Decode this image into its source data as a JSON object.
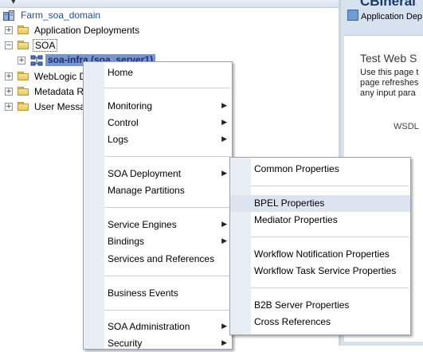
{
  "tree": {
    "root_label": "Farm_soa_domain",
    "items": [
      {
        "label": "Application Deployments",
        "expander": "+"
      },
      {
        "label": "SOA",
        "expander": "−"
      },
      {
        "label": "soa-infra (soa_server1)",
        "expander": "+"
      },
      {
        "label": "WebLogic Do",
        "expander": "+"
      },
      {
        "label": "Metadata Re",
        "expander": "+"
      },
      {
        "label": "User Messag",
        "expander": "+"
      }
    ]
  },
  "right_pane": {
    "title": "CBIneral",
    "app_deploy_label": "Application Dep",
    "test_heading": "Test Web S",
    "desc_lines": [
      "Use this page t",
      "page refreshes",
      "any input para"
    ],
    "wsdl_label": "WSDL"
  },
  "context_menu": {
    "items": [
      {
        "label": "Home",
        "submenu": false
      },
      {
        "label": "Monitoring",
        "submenu": true
      },
      {
        "label": "Control",
        "submenu": true
      },
      {
        "label": "Logs",
        "submenu": true
      },
      {
        "label": "SOA Deployment",
        "submenu": true
      },
      {
        "label": "Manage Partitions",
        "submenu": false
      },
      {
        "label": "Service Engines",
        "submenu": true
      },
      {
        "label": "Bindings",
        "submenu": true
      },
      {
        "label": "Services and References",
        "submenu": false
      },
      {
        "label": "Business Events",
        "submenu": false
      },
      {
        "label": "SOA Administration",
        "submenu": true
      },
      {
        "label": "Security",
        "submenu": true
      }
    ],
    "arrow_glyph": "▶"
  },
  "submenu": {
    "items": [
      {
        "label": "Common Properties"
      },
      {
        "label": "BPEL Properties",
        "highlighted": true
      },
      {
        "label": "Mediator Properties"
      },
      {
        "label": "Workflow Notification Properties"
      },
      {
        "label": "Workflow Task Service Properties"
      },
      {
        "label": "B2B Server Properties"
      },
      {
        "label": "Cross References"
      }
    ]
  },
  "colors": {
    "highlight": "#dbe4f0",
    "selected_node": "#7a95c9",
    "link": "#1f4e9c"
  },
  "icons": [
    "chevron-down-icon",
    "domain-icon",
    "folder-icon",
    "soa-infra-icon",
    "submenu-arrow-icon"
  ]
}
